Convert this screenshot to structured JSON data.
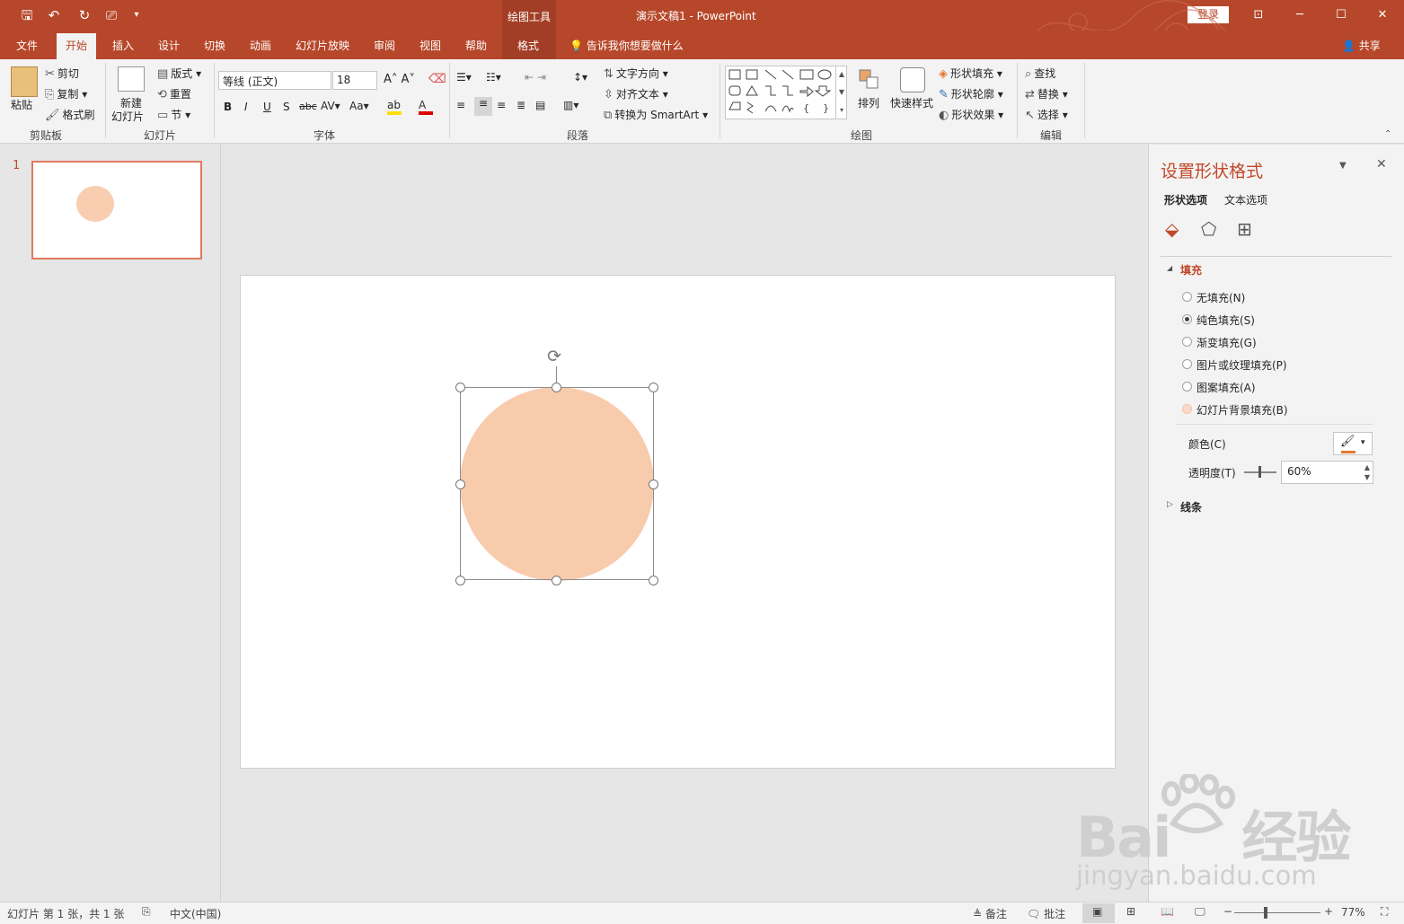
{
  "titlebar": {
    "title": "演示文稿1  -  PowerPoint",
    "drawing_tools": "绘图工具",
    "login": "登录",
    "share": "共享"
  },
  "tabs": [
    "文件",
    "开始",
    "插入",
    "设计",
    "切换",
    "动画",
    "幻灯片放映",
    "审阅",
    "视图",
    "帮助"
  ],
  "format_tab": "格式",
  "active_tab": "开始",
  "tell_me": "告诉我你想要做什么",
  "ribbon": {
    "clipboard": {
      "paste": "粘贴",
      "cut": "剪切",
      "copy": "复制",
      "format_painter": "格式刷",
      "label": "剪贴板"
    },
    "slides": {
      "new_slide_1": "新建",
      "new_slide_2": "幻灯片",
      "layout": "版式",
      "reset": "重置",
      "section": "节",
      "label": "幻灯片"
    },
    "font": {
      "family": "等线 (正文)",
      "size": "18",
      "label": "字体"
    },
    "paragraph": {
      "text_direction": "文字方向",
      "align_text": "对齐文本",
      "smartart": "转换为 SmartArt",
      "label": "段落"
    },
    "drawing": {
      "arrange": "排列",
      "quick_styles": "快速样式",
      "shape_fill": "形状填充",
      "shape_outline": "形状轮廓",
      "shape_effects": "形状效果",
      "label": "绘图"
    },
    "editing": {
      "find": "查找",
      "replace": "替换",
      "select": "选择",
      "label": "编辑"
    }
  },
  "thumbnail": {
    "number": "1"
  },
  "format_pane": {
    "title": "设置形状格式",
    "tab_shape": "形状选项",
    "tab_text": "文本选项",
    "fill_header": "填充",
    "options": [
      "无填充(N)",
      "纯色填充(S)",
      "渐变填充(G)",
      "图片或纹理填充(P)",
      "图案填充(A)",
      "幻灯片背景填充(B)"
    ],
    "selected_option": 1,
    "color_label": "颜色(C)",
    "transparency_label": "透明度(T)",
    "transparency_value": "60%",
    "line_header": "线条",
    "fill_color": "#f8cbad"
  },
  "status": {
    "slide_info": "幻灯片 第 1 张，共 1 张",
    "language": "中文(中国)",
    "notes": "备注",
    "comments": "批注",
    "zoom": "77%"
  },
  "watermark": {
    "brand": "Bai du 经验",
    "url": "jingyan.baidu.com"
  }
}
